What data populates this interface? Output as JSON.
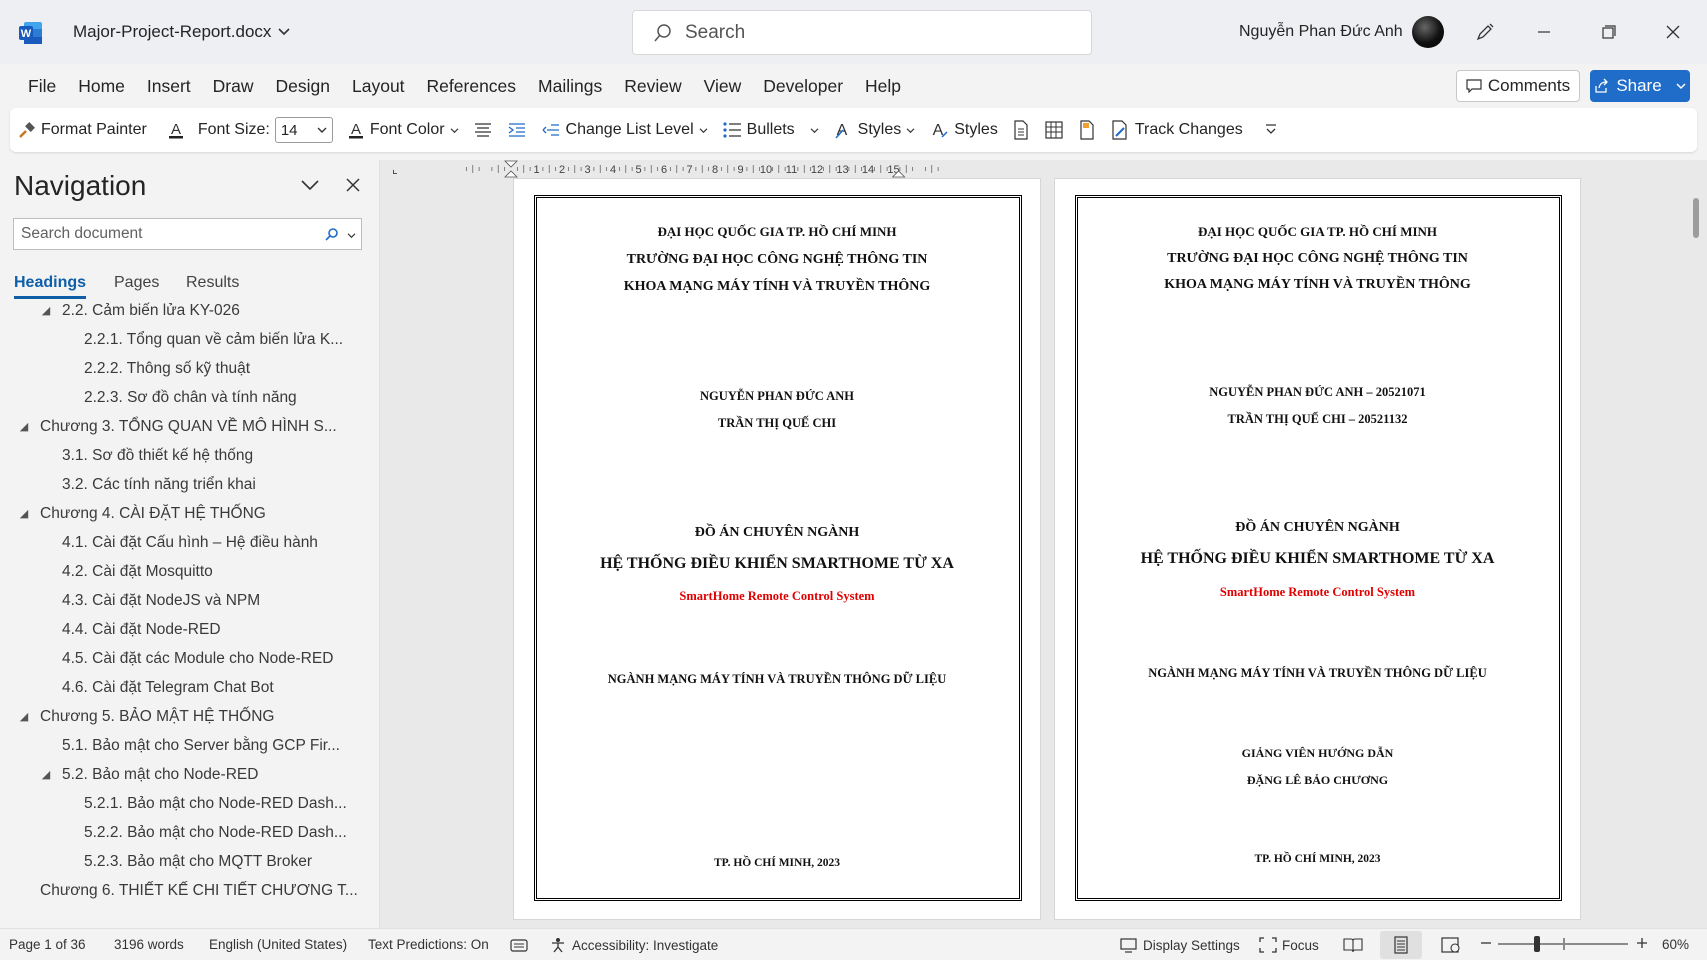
{
  "titlebar": {
    "doc_title": "Major-Project-Report.docx",
    "search_placeholder": "Search",
    "user_name": "Nguyễn Phan Đức Anh"
  },
  "menu": [
    "File",
    "Home",
    "Insert",
    "Draw",
    "Design",
    "Layout",
    "References",
    "Mailings",
    "Review",
    "View",
    "Developer",
    "Help"
  ],
  "actions": {
    "comments": "Comments",
    "share": "Share"
  },
  "ribbon": {
    "format_painter": "Format Painter",
    "font_size_label": "Font Size:",
    "font_size_value": "14",
    "font_color": "Font Color",
    "change_list_level": "Change List Level",
    "bullets": "Bullets",
    "styles_dropdown": "Styles",
    "styles": "Styles",
    "track_changes": "Track Changes"
  },
  "navigation": {
    "title": "Navigation",
    "search_placeholder": "Search document",
    "tabs": [
      "Headings",
      "Pages",
      "Results"
    ],
    "items": [
      {
        "text": "2.2. Cảm biến lửa KY-026",
        "level": 2,
        "caret": "down"
      },
      {
        "text": "2.2.1. Tổng quan về cảm biến lửa K...",
        "level": 3,
        "caret": ""
      },
      {
        "text": "2.2.2. Thông số kỹ thuật",
        "level": 3,
        "caret": ""
      },
      {
        "text": "2.2.3. Sơ đồ chân và tính năng",
        "level": 3,
        "caret": ""
      },
      {
        "text": "Chương 3. TỔNG QUAN VỀ MÔ HÌNH S...",
        "level": 1,
        "caret": "down"
      },
      {
        "text": "3.1. Sơ đồ thiết kế hệ thống",
        "level": 2,
        "caret": ""
      },
      {
        "text": "3.2. Các tính năng triển khai",
        "level": 2,
        "caret": ""
      },
      {
        "text": "Chương 4. CÀI ĐẶT HỆ THỐNG",
        "level": 1,
        "caret": "down"
      },
      {
        "text": "4.1. Cài đặt Cấu hình – Hệ điều hành",
        "level": 2,
        "caret": ""
      },
      {
        "text": "4.2. Cài đặt Mosquitto",
        "level": 2,
        "caret": ""
      },
      {
        "text": "4.3. Cài đặt NodeJS và NPM",
        "level": 2,
        "caret": ""
      },
      {
        "text": "4.4. Cài đặt Node-RED",
        "level": 2,
        "caret": ""
      },
      {
        "text": "4.5. Cài đặt các Module cho Node-RED",
        "level": 2,
        "caret": ""
      },
      {
        "text": "4.6. Cài đặt Telegram Chat Bot",
        "level": 2,
        "caret": ""
      },
      {
        "text": "Chương 5. BẢO MẬT HỆ THỐNG",
        "level": 1,
        "caret": "down"
      },
      {
        "text": "5.1. Bảo mật cho Server bằng GCP Fir...",
        "level": 2,
        "caret": ""
      },
      {
        "text": "5.2. Bảo mật cho Node-RED",
        "level": 2,
        "caret": "down"
      },
      {
        "text": "5.2.1. Bảo mật cho Node-RED Dash...",
        "level": 3,
        "caret": ""
      },
      {
        "text": "5.2.2. Bảo mật cho Node-RED Dash...",
        "level": 3,
        "caret": ""
      },
      {
        "text": "5.2.3. Bảo mật cho MQTT Broker",
        "level": 3,
        "caret": ""
      },
      {
        "text": "Chương 6. THIẾT KẾ CHI TIẾT CHƯƠNG T...",
        "level": 1,
        "caret": ""
      }
    ]
  },
  "ruler": {
    "labels": [
      "1",
      "2",
      "3",
      "4",
      "5",
      "6",
      "7",
      "8",
      "9",
      "10",
      "11",
      "12",
      "13",
      "14",
      "15"
    ]
  },
  "pages": [
    {
      "university": "ĐẠI HỌC QUỐC GIA TP. HỒ CHÍ MINH",
      "school": "TRƯỜNG ĐẠI HỌC CÔNG NGHỆ THÔNG TIN",
      "faculty": "KHOA MẠNG MÁY TÍNH VÀ TRUYỀN THÔNG",
      "author1": "NGUYỄN PHAN ĐỨC ANH",
      "author2": "TRẦN THỊ QUẾ CHI",
      "project_type": "ĐỒ ÁN CHUYÊN NGÀNH",
      "title_vi": "HỆ THỐNG ĐIỀU KHIỂN SMARTHOME TỪ XA",
      "title_en": "SmartHome Remote Control System",
      "major": "NGÀNH MẠNG MÁY TÍNH VÀ TRUYỀN THÔNG DỮ LIỆU",
      "place_year": "TP. HỒ CHÍ MINH, 2023"
    },
    {
      "university": "ĐẠI HỌC QUỐC GIA TP. HỒ CHÍ MINH",
      "school": "TRƯỜNG ĐẠI HỌC CÔNG NGHỆ THÔNG TIN",
      "faculty": "KHOA MẠNG MÁY TÍNH VÀ TRUYỀN THÔNG",
      "author1": "NGUYỄN PHAN ĐỨC ANH – 20521071",
      "author2": "TRẦN THỊ QUẾ CHI – 20521132",
      "project_type": "ĐỒ ÁN CHUYÊN NGÀNH",
      "title_vi": "HỆ THỐNG ĐIỀU KHIỂN SMARTHOME TỪ XA",
      "title_en": "SmartHome Remote Control System",
      "major": "NGÀNH MẠNG MÁY TÍNH VÀ TRUYỀN THÔNG DỮ LIỆU",
      "advisor_label": "GIẢNG VIÊN HƯỚNG DẪN",
      "advisor_name": "ĐẶNG LÊ BẢO CHƯƠNG",
      "place_year": "TP. HỒ CHÍ MINH, 2023"
    }
  ],
  "status": {
    "page": "Page 1 of 36",
    "words": "3196 words",
    "language": "English (United States)",
    "predictions": "Text Predictions: On",
    "accessibility": "Accessibility: Investigate",
    "display_settings": "Display Settings",
    "focus": "Focus",
    "zoom": "60%"
  },
  "colors": {
    "accent": "#1f6cc9",
    "title_en": "#e00000",
    "nav_tab_active": "#0f5ea8"
  }
}
